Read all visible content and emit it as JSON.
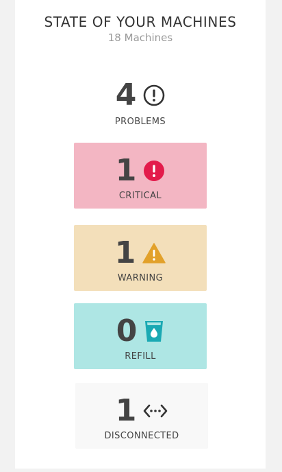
{
  "header": {
    "title": "STATE OF YOUR MACHINES",
    "subtitle": "18 Machines"
  },
  "summary": {
    "count": "4",
    "label": "PROBLEMS",
    "icon": "exclamation-circle-outline-icon"
  },
  "statuses": [
    {
      "count": "1",
      "label": "CRITICAL",
      "icon": "exclamation-circle-icon",
      "bg": "#f3b6c3",
      "icon_color": "#e31b4b"
    },
    {
      "count": "1",
      "label": "WARNING",
      "icon": "warning-triangle-icon",
      "bg": "#f3dfba",
      "icon_color": "#e2a12a"
    },
    {
      "count": "0",
      "label": "REFILL",
      "icon": "water-cup-icon",
      "bg": "#aee6e4",
      "icon_color": "#1aa9b3"
    },
    {
      "count": "1",
      "label": "DISCONNECTED",
      "icon": "disconnected-arrows-icon",
      "bg": "#f8f8f8",
      "icon_color": "#333333"
    }
  ]
}
